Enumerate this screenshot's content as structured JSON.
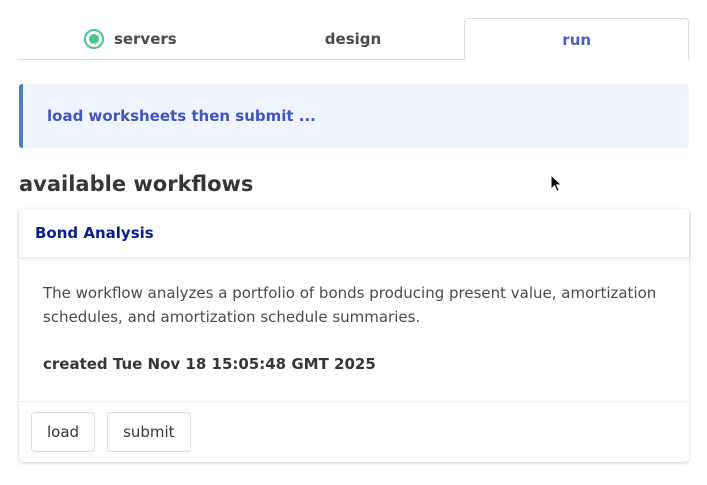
{
  "tabs": [
    {
      "label": "servers",
      "icon": "status-connected-icon",
      "status_color": "#48c78e"
    },
    {
      "label": "design"
    },
    {
      "label": "run",
      "active": true
    }
  ],
  "notification": {
    "text": "load worksheets then submit ..."
  },
  "section": {
    "title": "available workflows"
  },
  "workflow": {
    "title": "Bond Analysis",
    "description": "The workflow analyzes a portfolio of bonds producing present value, amortization schedules, and amortization schedule summaries.",
    "created": "created Tue Nov 18 15:05:48 GMT 2025",
    "load_label": "load",
    "submit_label": "submit"
  },
  "colors": {
    "accent": "#485fc7",
    "info_bg": "#eff5fe",
    "info_border": "#4c80c2",
    "card_title": "#0a1f8f"
  }
}
